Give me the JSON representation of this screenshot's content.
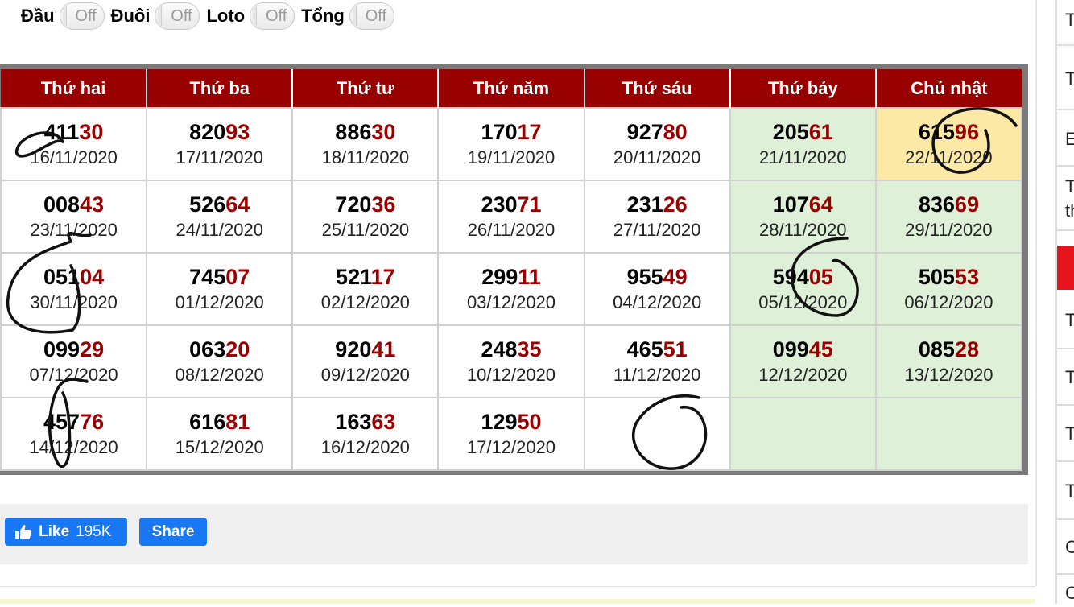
{
  "toggles": [
    {
      "label": "Đầu",
      "state": "Off"
    },
    {
      "label": "Đuôi",
      "state": "Off"
    },
    {
      "label": "Loto",
      "state": "Off"
    },
    {
      "label": "Tổng",
      "state": "Off"
    }
  ],
  "calendar": {
    "headers": [
      "Thứ hai",
      "Thứ ba",
      "Thứ tư",
      "Thứ năm",
      "Thứ sáu",
      "Thứ bảy",
      "Chủ nhật"
    ],
    "rows": [
      [
        {
          "head": "411",
          "tail": "30",
          "date": "16/11/2020"
        },
        {
          "head": "820",
          "tail": "93",
          "date": "17/11/2020"
        },
        {
          "head": "886",
          "tail": "30",
          "date": "18/11/2020"
        },
        {
          "head": "170",
          "tail": "17",
          "date": "19/11/2020"
        },
        {
          "head": "927",
          "tail": "80",
          "date": "20/11/2020"
        },
        {
          "head": "205",
          "tail": "61",
          "date": "21/11/2020"
        },
        {
          "head": "615",
          "tail": "96",
          "date": "22/11/2020"
        }
      ],
      [
        {
          "head": "008",
          "tail": "43",
          "date": "23/11/2020"
        },
        {
          "head": "526",
          "tail": "64",
          "date": "24/11/2020"
        },
        {
          "head": "720",
          "tail": "36",
          "date": "25/11/2020"
        },
        {
          "head": "230",
          "tail": "71",
          "date": "26/11/2020"
        },
        {
          "head": "231",
          "tail": "26",
          "date": "27/11/2020"
        },
        {
          "head": "107",
          "tail": "64",
          "date": "28/11/2020"
        },
        {
          "head": "836",
          "tail": "69",
          "date": "29/11/2020"
        }
      ],
      [
        {
          "head": "051",
          "tail": "04",
          "date": "30/11/2020"
        },
        {
          "head": "745",
          "tail": "07",
          "date": "01/12/2020"
        },
        {
          "head": "521",
          "tail": "17",
          "date": "02/12/2020"
        },
        {
          "head": "299",
          "tail": "11",
          "date": "03/12/2020"
        },
        {
          "head": "955",
          "tail": "49",
          "date": "04/12/2020"
        },
        {
          "head": "594",
          "tail": "05",
          "date": "05/12/2020"
        },
        {
          "head": "505",
          "tail": "53",
          "date": "06/12/2020"
        }
      ],
      [
        {
          "head": "099",
          "tail": "29",
          "date": "07/12/2020"
        },
        {
          "head": "063",
          "tail": "20",
          "date": "08/12/2020"
        },
        {
          "head": "920",
          "tail": "41",
          "date": "09/12/2020"
        },
        {
          "head": "248",
          "tail": "35",
          "date": "10/12/2020"
        },
        {
          "head": "465",
          "tail": "51",
          "date": "11/12/2020"
        },
        {
          "head": "099",
          "tail": "45",
          "date": "12/12/2020"
        },
        {
          "head": "085",
          "tail": "28",
          "date": "13/12/2020"
        }
      ],
      [
        {
          "head": "457",
          "tail": "76",
          "date": "14/12/2020"
        },
        {
          "head": "616",
          "tail": "81",
          "date": "15/12/2020"
        },
        {
          "head": "163",
          "tail": "63",
          "date": "16/12/2020"
        },
        {
          "head": "129",
          "tail": "50",
          "date": "17/12/2020"
        },
        {
          "head": "",
          "tail": "",
          "date": ""
        },
        {
          "head": "",
          "tail": "",
          "date": ""
        },
        {
          "head": "",
          "tail": "",
          "date": ""
        }
      ]
    ]
  },
  "social": {
    "like_label": "Like",
    "like_count": "195K",
    "share_label": "Share"
  },
  "sidebar": {
    "items": [
      "T",
      "T",
      "E",
      "T th",
      "T",
      "T",
      "T",
      "T",
      "C",
      "C"
    ]
  },
  "colors": {
    "header_bg": "#990000",
    "tail_digits": "#990000",
    "weekend_bg": "#dff0d8",
    "today_bg": "#fce9a6",
    "facebook_blue": "#1877f2",
    "sidebar_red": "#e8141c"
  }
}
